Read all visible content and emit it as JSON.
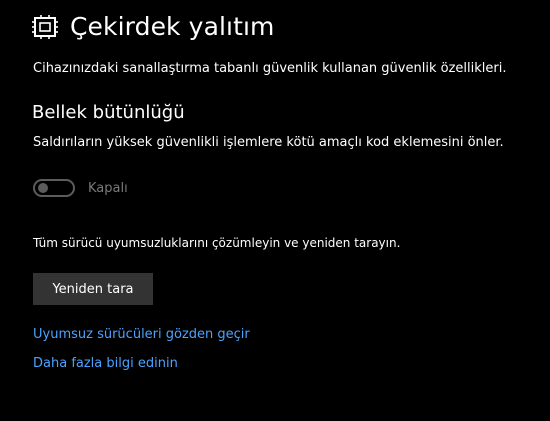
{
  "header": {
    "icon": "core-isolation-chip-icon",
    "title": "Çekirdek yalıtım"
  },
  "description": "Cihazınızdaki sanallaştırma tabanlı güvenlik kullanan güvenlik özellikleri.",
  "memory_integrity": {
    "title": "Bellek bütünlüğü",
    "description": "Saldırıların yüksek güvenlikli işlemlere kötü amaçlı kod eklemesini önler.",
    "toggle": {
      "state": "off",
      "label": "Kapalı",
      "enabled": false
    }
  },
  "driver_note": "Tüm sürücü uyumsuzluklarını çözümleyin ve yeniden tarayın.",
  "rescan_button": "Yeniden tara",
  "links": {
    "review_drivers": "Uyumsuz sürücüleri gözden geçir",
    "learn_more": "Daha fazla bilgi edinin"
  },
  "colors": {
    "background": "#000000",
    "text": "#ffffff",
    "link": "#4aa3ff",
    "disabled": "#5c5c5c",
    "button_bg": "#333333"
  }
}
